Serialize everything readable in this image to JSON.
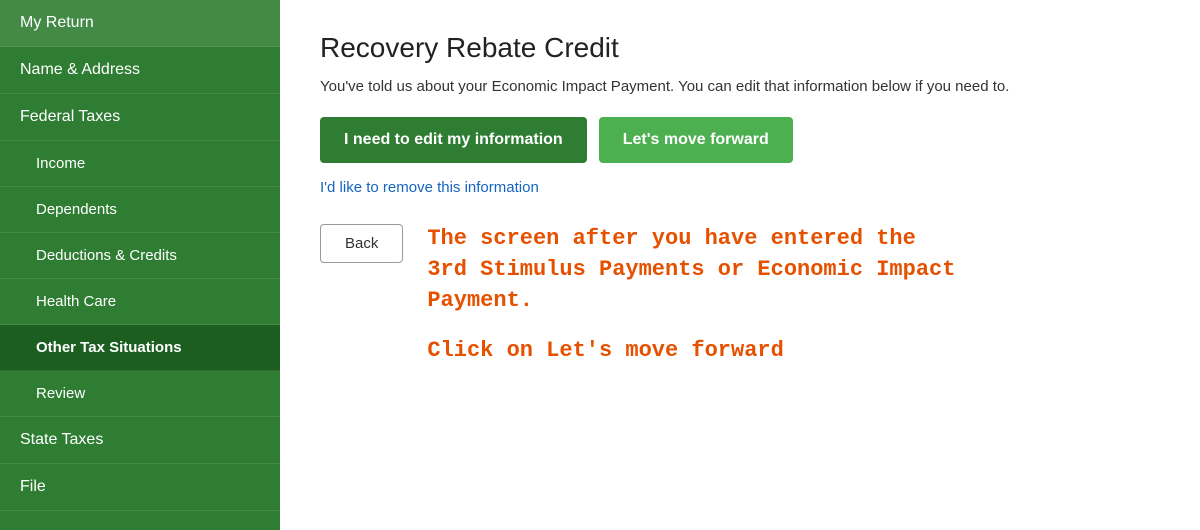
{
  "sidebar": {
    "items": [
      {
        "id": "my-return",
        "label": "My Return",
        "active": false,
        "sub": false
      },
      {
        "id": "name-address",
        "label": "Name & Address",
        "active": false,
        "sub": false
      },
      {
        "id": "federal-taxes",
        "label": "Federal Taxes",
        "active": false,
        "sub": false
      },
      {
        "id": "income",
        "label": "Income",
        "active": false,
        "sub": true
      },
      {
        "id": "dependents",
        "label": "Dependents",
        "active": false,
        "sub": true
      },
      {
        "id": "deductions-credits",
        "label": "Deductions & Credits",
        "active": false,
        "sub": true
      },
      {
        "id": "health-care",
        "label": "Health Care",
        "active": false,
        "sub": true
      },
      {
        "id": "other-tax-situations",
        "label": "Other Tax Situations",
        "active": true,
        "sub": true
      },
      {
        "id": "review",
        "label": "Review",
        "active": false,
        "sub": true
      },
      {
        "id": "state-taxes",
        "label": "State Taxes",
        "active": false,
        "sub": false
      },
      {
        "id": "file",
        "label": "File",
        "active": false,
        "sub": false
      }
    ]
  },
  "main": {
    "page_title": "Recovery Rebate Credit",
    "subtitle": "You've told us about your Economic Impact Payment. You can edit that information below if you need to.",
    "btn_edit_label": "I need to edit my information",
    "btn_forward_label": "Let's move forward",
    "remove_link_label": "I'd like to remove this information",
    "btn_back_label": "Back",
    "annotation_line1": "The screen after you have entered the",
    "annotation_line2": "3rd Stimulus Payments or Economic Impact",
    "annotation_line3": "Payment.",
    "annotation_cta": "Click on Let's move forward"
  }
}
